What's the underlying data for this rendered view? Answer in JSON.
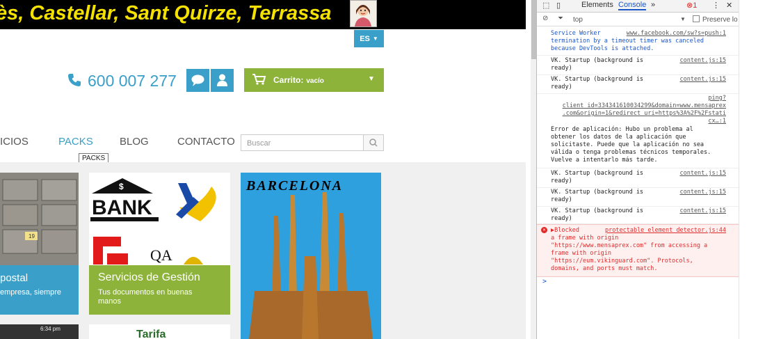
{
  "site": {
    "banner_text": "ès, Castellar, Sant Quirze, Terrassa",
    "lang_label": "ES",
    "phone": "600 007 277",
    "cart": {
      "label": "Carrito:",
      "status": "vacío"
    },
    "nav": {
      "services": "VICIOS",
      "packs": "PACKS",
      "blog": "BLOG",
      "contact": "CONTACTO"
    },
    "tooltip": "PACKS",
    "search_placeholder": "Buscar",
    "cards": [
      {
        "title": "postal",
        "text": "empresa, siempre"
      },
      {
        "title": "Servicios de Gestión",
        "text": "Tus documentos en buenas manos",
        "logos": {
          "bank": "BANK",
          "qa": "QA"
        }
      },
      {
        "title": "BARCELONA"
      }
    ],
    "phone_status": "6:34 pm",
    "card_mid2_text": "Tarifa"
  },
  "devtools": {
    "tabs": {
      "elements": "Elements",
      "console": "Console",
      "more": "»"
    },
    "error_count": "1",
    "context": "top",
    "preserve_log": "Preserve lo",
    "logs": [
      {
        "msg": "Service Worker\ntermination by a timeout timer was canceled\nbecause DevTools is attached.",
        "src": "www.facebook.com/sw?s=push:1"
      },
      {
        "msg": "VK. Startup (background is\nready)",
        "src": "content.js:15"
      },
      {
        "msg": "VK. Startup (background is\nready)",
        "src": "content.js:15"
      },
      {
        "msg": "Error de aplicación: Hubo un problema al\nobtener los datos de la aplicación que\nsolicitaste. Puede que la aplicación no sea\nválida o tenga problemas técnicos temporales.\nVuelve a intentarlo más tarde.",
        "src": "ping?\nclient_id=334341610034299&domain=www.mensaprex\n.com&origin=1&redirect_uri=https%3A%2F%2Fstati\ncx…:1"
      },
      {
        "msg": "VK. Startup (background is\nready)",
        "src": "content.js:15"
      },
      {
        "msg": "VK. Startup (background is\nready)",
        "src": "content.js:15"
      },
      {
        "msg": "VK. Startup (background is\nready)",
        "src": "content.js:15"
      },
      {
        "msg": "▶Blocked\na frame with origin\n\"https://www.mensaprex.com\" from accessing a\nframe with origin\n\"https://eum.vikinguard.com\". Protocols,\ndomains, and ports must match.",
        "src": "protectable element detector.js:44"
      }
    ],
    "prompt": ">"
  }
}
